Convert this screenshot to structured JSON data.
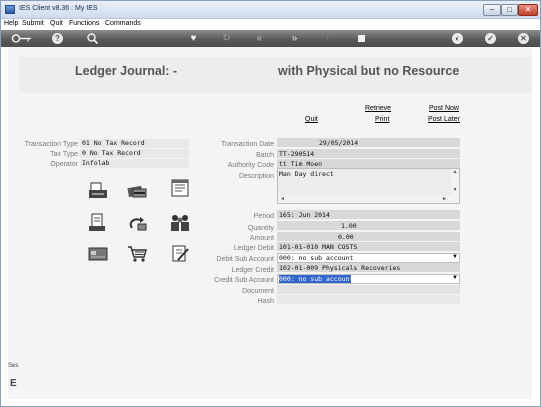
{
  "window": {
    "title": "IES Client v8.36 : My IES"
  },
  "menu": [
    "Help",
    "Submit",
    "Quit",
    "Functions",
    "Commands"
  ],
  "toolbar": {
    "icons": [
      "key-icon",
      "help-icon",
      "search-icon",
      "heart-icon",
      "refresh-icon",
      "rewind-icon",
      "forward-icon",
      "upload-icon",
      "stop-icon",
      "globe-icon",
      "check-icon",
      "close-icon"
    ]
  },
  "heading": {
    "left": "Ledger Journal: -",
    "right": "with Physical but no Resource"
  },
  "actions": {
    "retrieve": "Retrieve",
    "post_now": "Post Now",
    "quit": "Quit",
    "print": "Print",
    "post_later": "Post Later"
  },
  "left_info": {
    "transaction_type_label": "Transaction Type",
    "transaction_type_value": "01 No Tax Record",
    "tax_type_label": "Tax Type",
    "tax_type_value": "0 No Tax Record",
    "operator_label": "Operator",
    "operator_value": "Infolab"
  },
  "form": {
    "transaction_date_label": "Transaction Date",
    "transaction_date_value": "29/05/2014",
    "batch_label": "Batch",
    "batch_value": "TT-290514",
    "authority_code_label": "Authority Code",
    "authority_code_value": "tt Tim Moen",
    "description_label": "Description",
    "description_value": "Man Day direct",
    "period_label": "Period",
    "period_value": "165: Jun 2014",
    "quantity_label": "Quantity",
    "quantity_value": "1.00",
    "amount_label": "Amount",
    "amount_value": "0.00",
    "ledger_debit_label": "Ledger Debit",
    "ledger_debit_value": "101-01-010 MAN COSTS",
    "debit_sub_account_label": "Debit Sub Account",
    "debit_sub_account_value": "000: no sub account",
    "ledger_credit_label": "Ledger Credit",
    "ledger_credit_value": "102-01-009 Physicals Recoveries",
    "credit_sub_account_label": "Credit Sub Account",
    "credit_sub_account_value": "000: no sub account",
    "document_label": "Document",
    "hash_label": "Hash"
  },
  "bottom": {
    "strip_text": "Ses",
    "mark": "E"
  },
  "colors": {
    "toolbar": "#5a5a5a",
    "selection": "#3366cc",
    "field_bg": "#d8d8d8"
  }
}
